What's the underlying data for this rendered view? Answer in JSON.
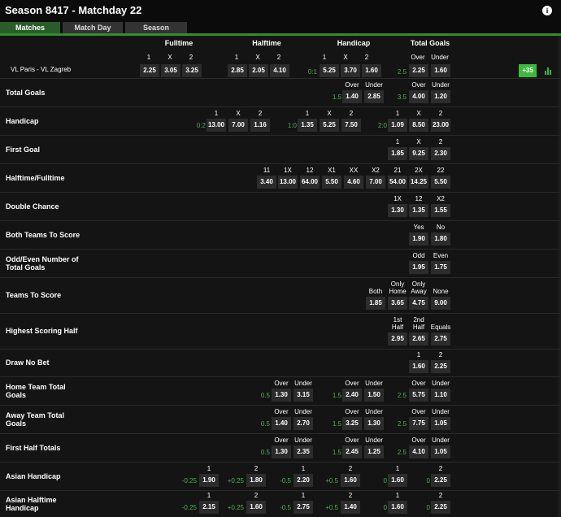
{
  "header": {
    "title": "Season 8417 - Matchday 22",
    "info_icon": "info-icon"
  },
  "tabs": [
    "Matches",
    "Match Day",
    "Season"
  ],
  "columns": {
    "fulltime": "Fulltime",
    "halftime": "Halftime",
    "handicap": "Handicap",
    "total_goals": "Total Goals"
  },
  "match": {
    "name": "VL Paris - VL Zagreb",
    "more_label": "+35",
    "stats_icon": "bar-chart-icon"
  },
  "accent": "#3db93d",
  "highlight": "#4caf50",
  "main_subheaders": [
    "1",
    "X",
    "2",
    "1",
    "X",
    "2",
    "1",
    "X",
    "2",
    "Over",
    "Under"
  ],
  "main_values": [
    "2.25",
    "3.05",
    "3.25",
    "2.85",
    "2.05",
    "4.10",
    "0:1",
    "5.25",
    "3.70",
    "1.60",
    "2.5",
    "2.25",
    "1.60"
  ],
  "markets": [
    {
      "label": "Total Goals",
      "subs": [
        "Over",
        "Under",
        "Over",
        "Under"
      ],
      "vals": [
        "1.5",
        "1.40",
        "2.85",
        "3.5",
        "4.00",
        "1.20"
      ]
    },
    {
      "label": "Handicap",
      "subs": [
        "1",
        "X",
        "2",
        "1",
        "X",
        "2",
        "1",
        "X",
        "2"
      ],
      "vals": [
        "0:2",
        "13.00",
        "7.00",
        "1.16",
        "1:0",
        "1.35",
        "5.25",
        "7.50",
        "2:0",
        "1.09",
        "8.50",
        "23.00"
      ]
    },
    {
      "label": "First Goal",
      "subs": [
        "1",
        "X",
        "2"
      ],
      "vals": [
        "1.85",
        "9.25",
        "2.30"
      ]
    },
    {
      "label": "Halftime/Fulltime",
      "subs": [
        "11",
        "1X",
        "12",
        "X1",
        "XX",
        "X2",
        "21",
        "2X",
        "22"
      ],
      "vals": [
        "3.40",
        "13.00",
        "64.00",
        "5.50",
        "4.60",
        "7.00",
        "54.00",
        "14.25",
        "5.50"
      ]
    },
    {
      "label": "Double Chance",
      "subs": [
        "1X",
        "12",
        "X2"
      ],
      "vals": [
        "1.30",
        "1.35",
        "1.55"
      ]
    },
    {
      "label": "Both Teams To Score",
      "subs": [
        "Yes",
        "No"
      ],
      "vals": [
        "1.90",
        "1.80"
      ]
    },
    {
      "label": "Odd/Even Number of\nTotal Goals",
      "subs": [
        "Odd",
        "Even"
      ],
      "vals": [
        "1.95",
        "1.75"
      ]
    },
    {
      "label": "Teams To Score",
      "subs": [
        "Both",
        "Only\nHome",
        "Only\nAway",
        "None"
      ],
      "vals": [
        "1.85",
        "3.65",
        "4.75",
        "9.00"
      ]
    },
    {
      "label": "Highest Scoring Half",
      "subs": [
        "1st\nHalf",
        "2nd\nHalf",
        "Equals"
      ],
      "vals": [
        "2.95",
        "2.65",
        "2.75"
      ]
    },
    {
      "label": "Draw No Bet",
      "subs": [
        "1",
        "2"
      ],
      "vals": [
        "1.60",
        "2.25"
      ]
    },
    {
      "label": "Home Team Total\nGoals",
      "subs": [
        "Over",
        "Under",
        "Over",
        "Under",
        "Over",
        "Under"
      ],
      "vals": [
        "0.5",
        "1.30",
        "3.15",
        "1.5",
        "2.40",
        "1.50",
        "2.5",
        "5.75",
        "1.10"
      ]
    },
    {
      "label": "Away Team Total\nGoals",
      "subs": [
        "Over",
        "Under",
        "Over",
        "Under",
        "Over",
        "Under"
      ],
      "vals": [
        "0.5",
        "1.40",
        "2.70",
        "1.5",
        "3.25",
        "1.30",
        "2.5",
        "7.75",
        "1.05"
      ]
    },
    {
      "label": "First Half Totals",
      "subs": [
        "Over",
        "Under",
        "Over",
        "Under",
        "Over",
        "Under"
      ],
      "vals": [
        "0.5",
        "1.30",
        "2.35",
        "1.5",
        "2.45",
        "1.25",
        "2.5",
        "4.10",
        "1.05"
      ]
    },
    {
      "label": "Asian Handicap",
      "subs": [
        "1",
        "2",
        "1",
        "2",
        "1",
        "2"
      ],
      "vals": [
        "-0.25",
        "1.90",
        "+0.25",
        "1.80",
        "-0.5",
        "2.20",
        "+0.5",
        "1.60",
        "0",
        "1.60",
        "0",
        "2.25"
      ]
    },
    {
      "label": "Asian Halftime\nHandicap",
      "subs": [
        "1",
        "2",
        "1",
        "2",
        "1",
        "2"
      ],
      "vals": [
        "-0.25",
        "2.15",
        "+0.25",
        "1.60",
        "-0.5",
        "2.75",
        "+0.5",
        "1.40",
        "0",
        "1.60",
        "0",
        "2.25"
      ]
    }
  ]
}
